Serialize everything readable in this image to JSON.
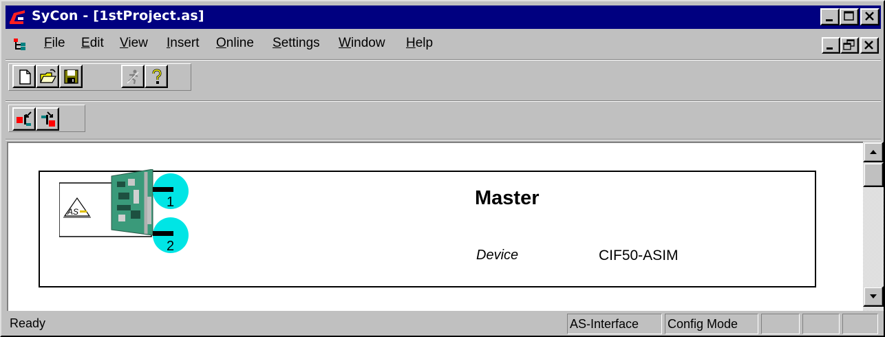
{
  "window": {
    "title": "SyCon - [1stProject.as]"
  },
  "menubar": {
    "items": [
      {
        "mnemonic": "F",
        "rest": "ile"
      },
      {
        "mnemonic": "E",
        "rest": "dit"
      },
      {
        "mnemonic": "V",
        "rest": "iew"
      },
      {
        "mnemonic": "I",
        "rest": "nsert"
      },
      {
        "mnemonic": "O",
        "rest": "nline"
      },
      {
        "mnemonic": "S",
        "rest": "ettings"
      },
      {
        "mnemonic": "W",
        "rest": "indow"
      },
      {
        "mnemonic": "H",
        "rest": "elp"
      }
    ]
  },
  "toolbar1": {
    "buttons": [
      "new-file-icon",
      "open-folder-icon",
      "save-disk-icon",
      "running-man-icon",
      "help-question-icon"
    ]
  },
  "toolbar2": {
    "buttons": [
      "insert-before-icon",
      "insert-after-icon"
    ]
  },
  "device": {
    "name": "Master",
    "field_label": "Device",
    "field_value": "CIF50-ASIM",
    "ports": [
      "1",
      "2"
    ],
    "logo_text": "AS-i"
  },
  "statusbar": {
    "message": "Ready",
    "panes": [
      "AS-Interface",
      "Config Mode",
      "",
      "",
      ""
    ]
  },
  "colors": {
    "titlebar": "#000080",
    "port_circle": "#00e5e5",
    "window_bg": "#c0c0c0"
  }
}
